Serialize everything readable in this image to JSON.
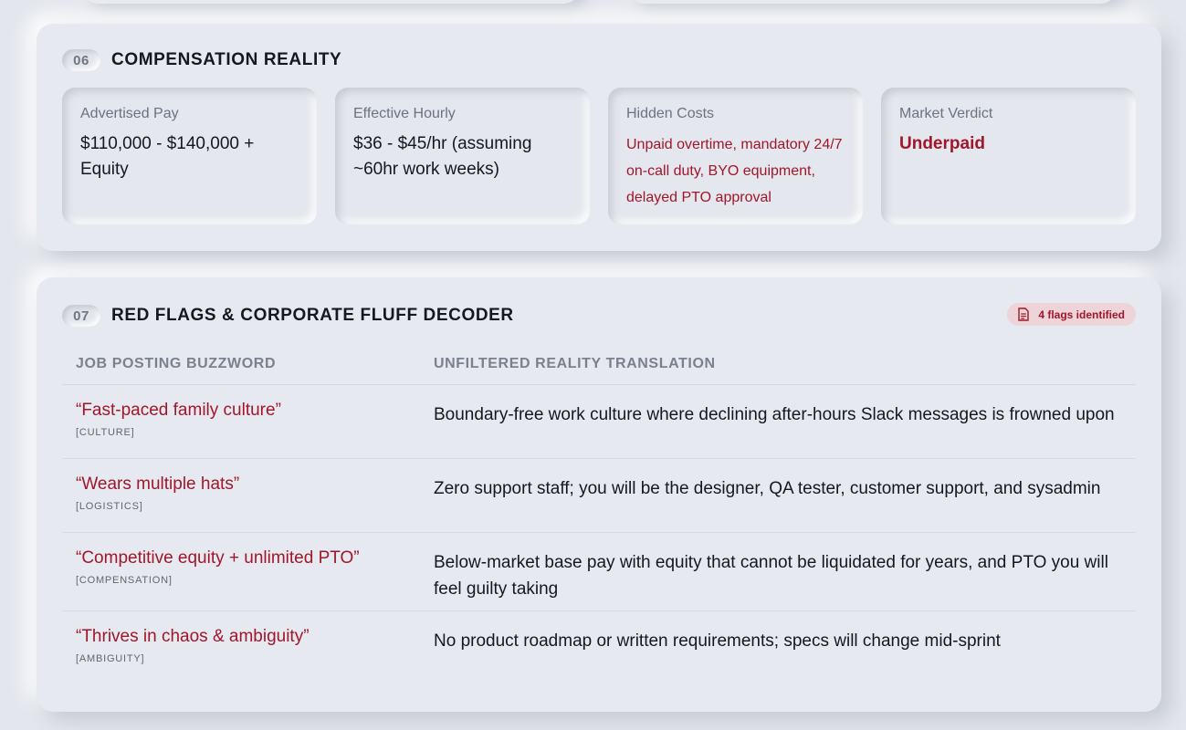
{
  "compensation": {
    "number": "06",
    "title": "COMPENSATION REALITY",
    "cards": [
      {
        "label": "Advertised Pay",
        "value": "$110,000 - $140,000 + Equity"
      },
      {
        "label": "Effective Hourly",
        "value": "$36 - $45/hr (assuming ~60hr work weeks)"
      },
      {
        "label": "Hidden Costs",
        "value": "Unpaid overtime, mandatory 24/7 on-call duty, BYO equipment, delayed PTO approval"
      },
      {
        "label": "Market Verdict",
        "value": "Underpaid"
      }
    ]
  },
  "red_flags": {
    "number": "07",
    "title": "RED FLAGS & CORPORATE FLUFF DECODER",
    "badge": "4 flags identified",
    "badge_icon": "document-icon",
    "columns": [
      "JOB POSTING BUZZWORD",
      "UNFILTERED REALITY TRANSLATION"
    ],
    "rows": [
      {
        "buzzword": "“Fast-paced family culture”",
        "category": "[CULTURE]",
        "reality": "Boundary-free work culture where declining after-hours Slack messages is frowned upon"
      },
      {
        "buzzword": "“Wears multiple hats”",
        "category": "[LOGISTICS]",
        "reality": "Zero support staff; you will be the designer, QA tester, customer support, and sysadmin"
      },
      {
        "buzzword": "“Competitive equity + unlimited PTO”",
        "category": "[COMPENSATION]",
        "reality": "Below-market base pay with equity that cannot be liquidated for years, and PTO you will feel guilty taking"
      },
      {
        "buzzword": "“Thrives in chaos & ambiguity”",
        "category": "[AMBIGUITY]",
        "reality": "No product roadmap or written requirements; specs will change mid-sprint"
      }
    ]
  },
  "colors": {
    "background": "#e3e6ec",
    "accent_red": "#a1162a",
    "badge_bg": "#ecd4d8",
    "muted_text": "#6b7380"
  }
}
